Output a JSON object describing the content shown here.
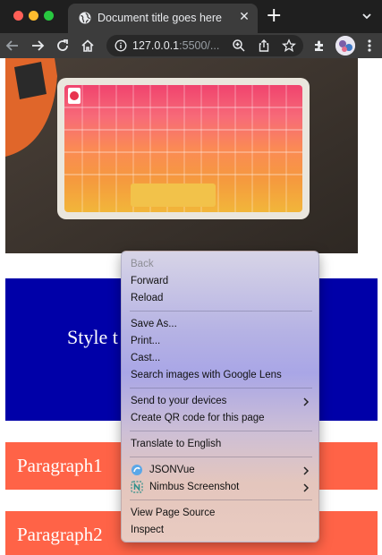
{
  "browser": {
    "tab_title": "Document title goes here",
    "tab_close": "✕",
    "new_tab": "+",
    "url_main": "127.0.0.1",
    "url_rest": ":5500/...",
    "icons": [
      "back-icon",
      "forward-icon",
      "reload-icon",
      "home-icon",
      "info-icon",
      "zoom-icon",
      "share-icon",
      "star-icon",
      "extensions-icon",
      "profile-avatar",
      "more-icon"
    ]
  },
  "page": {
    "blue_heading": "Style t",
    "paragraph1": "Paragraph1",
    "paragraph2": "Paragraph2",
    "colors": {
      "blue_block": "#0000a8",
      "paragraph_bg": "#ff6347"
    }
  },
  "context_menu": {
    "back": "Back",
    "forward": "Forward",
    "reload": "Reload",
    "save_as": "Save As...",
    "print": "Print...",
    "cast": "Cast...",
    "search_images": "Search images with Google Lens",
    "send_devices": "Send to your devices",
    "create_qr": "Create QR code for this page",
    "translate": "Translate to English",
    "jsonvue": "JSONVue",
    "nimbus": "Nimbus Screenshot",
    "view_source": "View Page Source",
    "inspect": "Inspect"
  }
}
